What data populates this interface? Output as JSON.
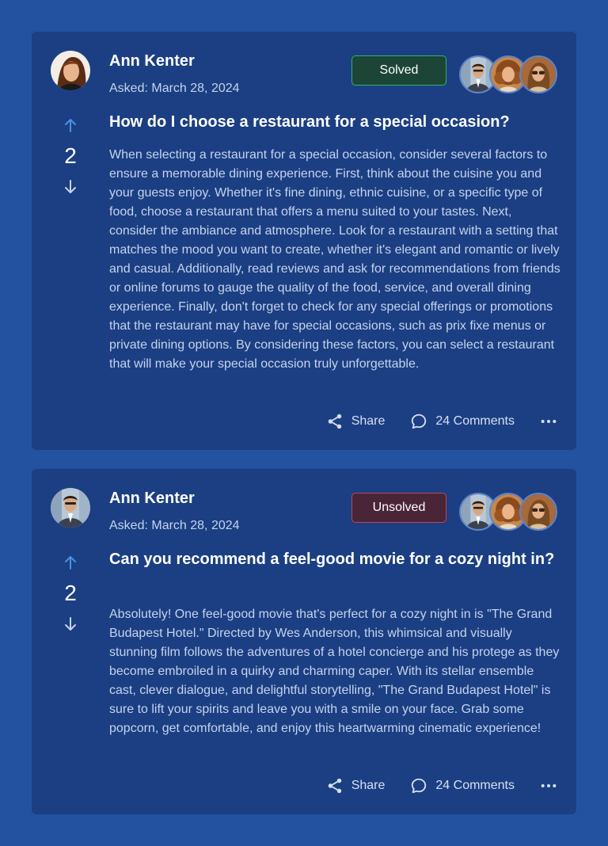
{
  "questions": [
    {
      "author": {
        "name": "Ann Kenter",
        "avatar_icon": "woman-portrait-avatar"
      },
      "asked": "Asked: March 28, 2024",
      "status": {
        "label": "Solved",
        "state": "solved",
        "color": "#2fb36b"
      },
      "participants": [
        "man-in-suit-avatar",
        "curly-hair-woman-avatar",
        "woman-sunglasses-avatar"
      ],
      "votes": "2",
      "title": "How do I choose a restaurant for a special occasion?",
      "body": "When selecting a restaurant for a special occasion, consider several factors to ensure a memorable dining experience. First, think about the cuisine you and your guests enjoy. Whether it's fine dining, ethnic cuisine, or a specific type of food, choose a restaurant that offers a menu suited to your tastes. Next, consider the ambiance and atmosphere. Look for a restaurant with a setting that matches the mood you want to create, whether it's elegant and romantic or lively and casual. Additionally, read reviews and ask for recommendations from friends or online forums to gauge the quality of the food, service, and overall dining experience. Finally, don't forget to check for any special offerings or promotions that the restaurant may have for special occasions, such as prix fixe menus or private dining options. By considering these factors, you can select a restaurant that will make your special occasion truly unforgettable.",
      "share_label": "Share",
      "comments_label": "24 Comments"
    },
    {
      "author": {
        "name": "Ann Kenter",
        "avatar_icon": "man-in-suit-avatar"
      },
      "asked": "Asked: March 28, 2024",
      "status": {
        "label": "Unsolved",
        "state": "unsolved",
        "color": "#c0445a"
      },
      "participants": [
        "man-in-suit-avatar",
        "curly-hair-woman-avatar",
        "woman-sunglasses-avatar"
      ],
      "votes": "2",
      "title": "Can you recommend a feel-good movie for a cozy night in?",
      "body": "Absolutely! One feel-good movie that's perfect for a cozy night in is \"The Grand Budapest Hotel.\" Directed by Wes Anderson, this whimsical and visually stunning film follows the adventures of a hotel concierge and his protege as they become embroiled in a quirky and charming caper. With its stellar ensemble cast, clever dialogue, and delightful storytelling, \"The Grand Budapest Hotel\" is sure to lift your spirits and leave you with a smile on your face. Grab some popcorn, get comfortable, and enjoy this heartwarming cinematic experience!",
      "share_label": "Share",
      "comments_label": "24 Comments"
    }
  ],
  "colors": {
    "page_background": "#2352a1",
    "card_background": "#1b3f82",
    "accent_blue": "#4a90e2"
  }
}
